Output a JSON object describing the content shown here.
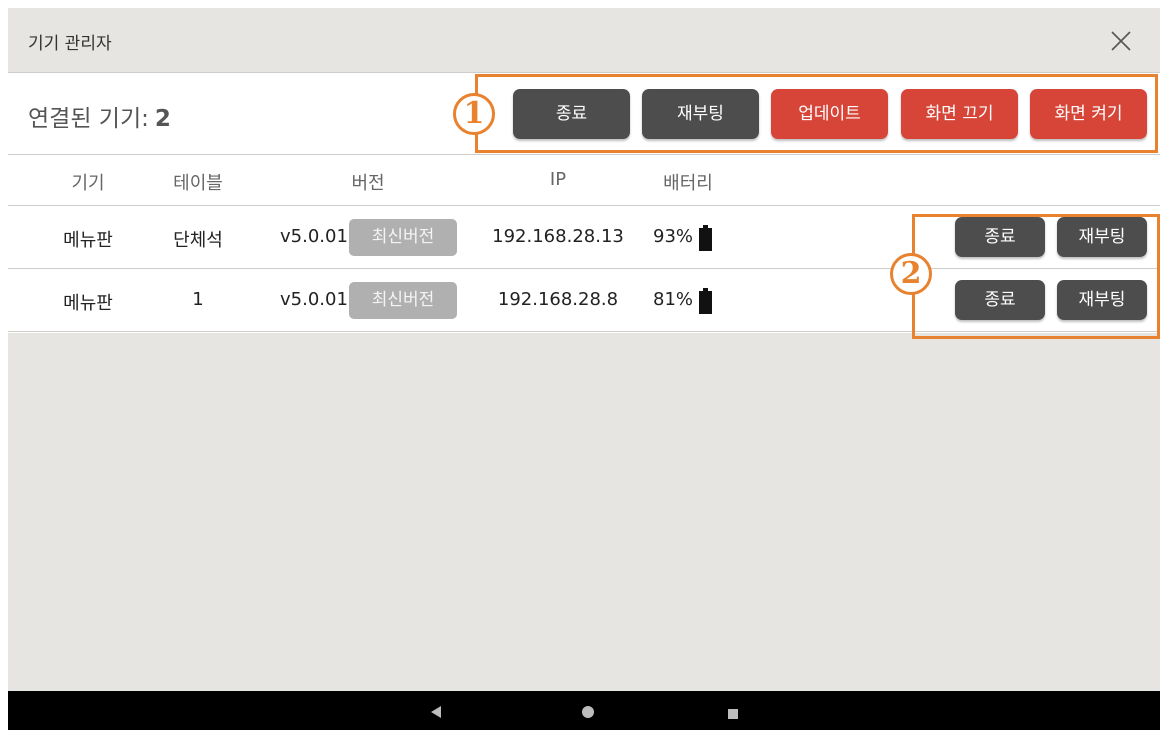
{
  "window": {
    "title": "기기 관리자"
  },
  "summary": {
    "label": "연결된 기기:",
    "count": "2"
  },
  "global_actions": {
    "shutdown": "종료",
    "reboot": "재부팅",
    "update": "업데이트",
    "screen_off": "화면 끄기",
    "screen_on": "화면 켜기"
  },
  "annotations": {
    "marker_1": "1",
    "marker_2": "2"
  },
  "table": {
    "headers": {
      "device": "기기",
      "table": "테이블",
      "version": "버전",
      "ip": "IP",
      "battery": "배터리"
    },
    "rows": [
      {
        "device": "메뉴판",
        "table": "단체석",
        "version": "v5.0.01",
        "version_status": "최신버전",
        "ip": "192.168.28.13",
        "battery": "93%",
        "battery_level": 0.93,
        "shutdown": "종료",
        "reboot": "재부팅"
      },
      {
        "device": "메뉴판",
        "table": "1",
        "version": "v5.0.01",
        "version_status": "최신버전",
        "ip": "192.168.28.8",
        "battery": "81%",
        "battery_level": 0.81,
        "shutdown": "종료",
        "reboot": "재부팅"
      }
    ]
  },
  "icons": {
    "close": "close-icon",
    "battery": "battery-icon",
    "nav_back": "back-triangle-icon",
    "nav_home": "home-circle-icon",
    "nav_recents": "recents-square-icon"
  },
  "colors": {
    "accent_dark": "#4d4d4d",
    "accent_red": "#d64538",
    "highlight": "#e8822e",
    "badge_gray": "#b0b0b0"
  }
}
